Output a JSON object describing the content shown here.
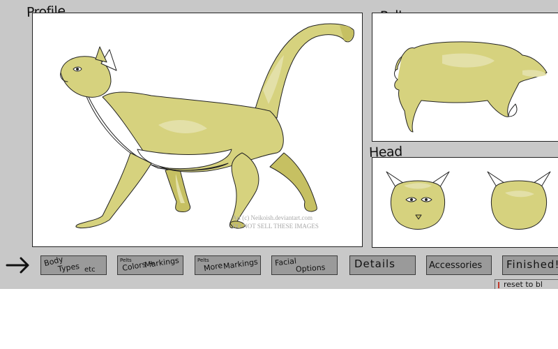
{
  "labels": {
    "profile": "Profile",
    "pelt": "Pelt",
    "head": "Head"
  },
  "credit": {
    "line1": "Art (c) Neikoish.deviantart.com",
    "line2": "DO NOT SELL THESE IMAGES"
  },
  "colors": {
    "background": "#c8c8c8",
    "fur_base": "#d6d27e",
    "fur_light": "#e3e0a8",
    "fur_dark": "#c6c062",
    "white": "#ffffff",
    "button": "#9a9a9a"
  },
  "nav": {
    "arrow_icon": "right-arrow-icon",
    "body_types": {
      "line1": "Body",
      "line2": "Types",
      "line3": "etc"
    },
    "colors_markings": {
      "small": "Pelts",
      "line1": "Colors +",
      "line2": "Markings"
    },
    "more_markings": {
      "small": "Pelts",
      "line1": "More",
      "line2": "Markings"
    },
    "facial_options": {
      "line1": "Facial",
      "line2": "Options"
    },
    "details": "Details",
    "accessories": "Accessories",
    "finished": "Finished!",
    "reset": "reset to bl"
  }
}
